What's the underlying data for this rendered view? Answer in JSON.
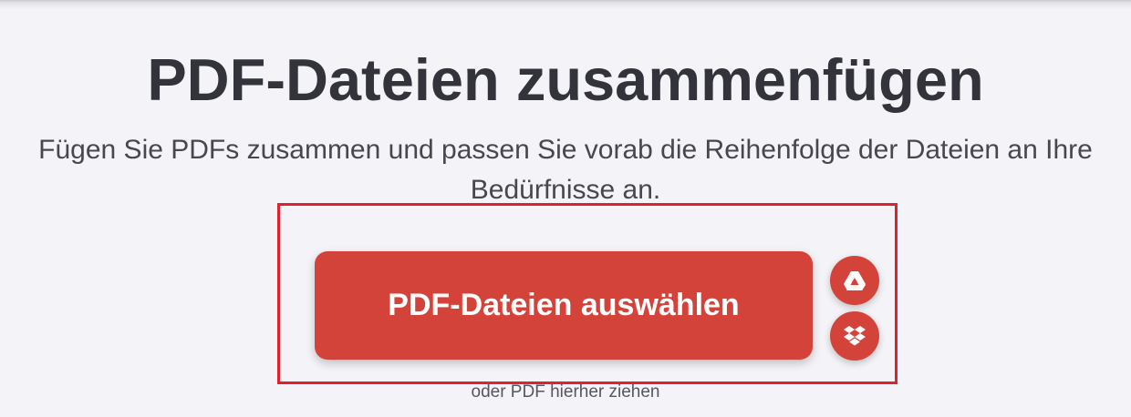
{
  "header": {
    "title": "PDF-Dateien zusammenfügen",
    "subtitle": "Fügen Sie PDFs zusammen und passen Sie vorab die Reihenfolge der Dateien an Ihre Bedürfnisse an."
  },
  "upload": {
    "select_label": "PDF-Dateien auswählen",
    "drop_hint": "oder PDF hierher ziehen",
    "cloud_buttons": [
      {
        "icon": "google-drive-icon"
      },
      {
        "icon": "dropbox-icon"
      }
    ]
  },
  "colors": {
    "accent": "#d4433a",
    "highlight_border": "#e1212f",
    "background": "#f4f4f8",
    "heading_text": "#33333b"
  }
}
